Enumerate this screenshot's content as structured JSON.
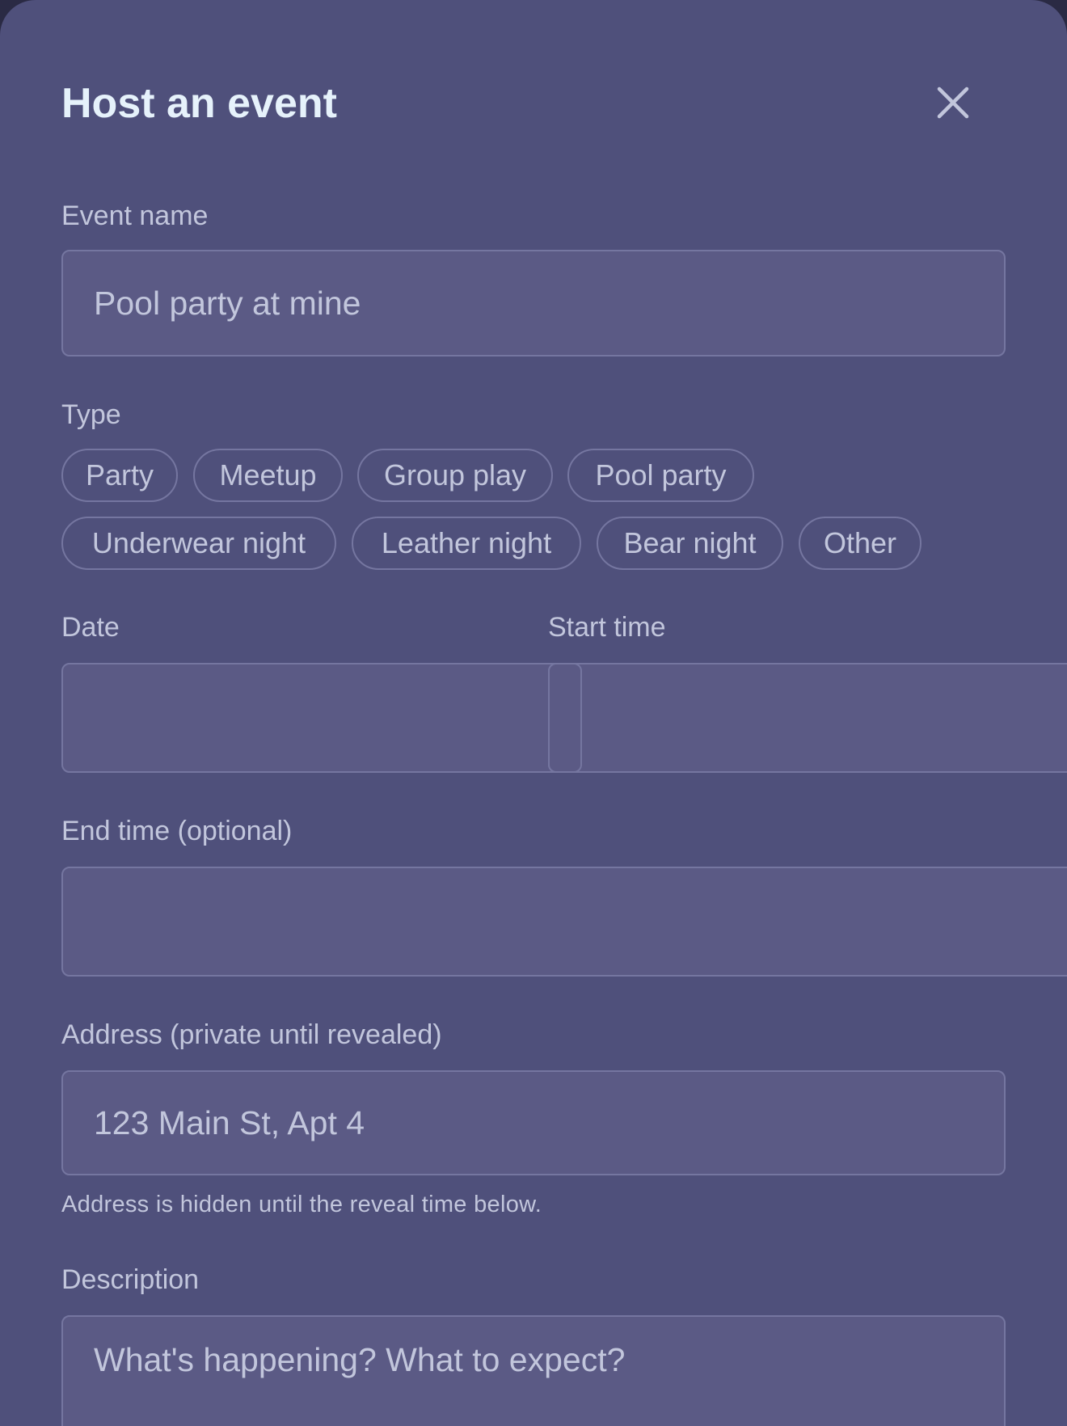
{
  "dialog": {
    "title": "Host an event",
    "close_icon": "close-icon"
  },
  "event_name": {
    "label": "Event name",
    "placeholder": "Pool party at mine"
  },
  "type": {
    "label": "Type",
    "options": [
      "Party",
      "Meetup",
      "Group play",
      "Pool party",
      "Underwear night",
      "Leather night",
      "Bear night",
      "Other"
    ]
  },
  "date": {
    "label": "Date",
    "value": ""
  },
  "start_time": {
    "label": "Start time",
    "value": ""
  },
  "end_time": {
    "label": "End time (optional)",
    "value": ""
  },
  "address": {
    "label": "Address (private until revealed)",
    "placeholder": "123 Main St, Apt 4",
    "hint": "Address is hidden until the reveal time below."
  },
  "description": {
    "label": "Description",
    "placeholder": "What's happening? What to expect?"
  },
  "colors": {
    "background": "#4f507b",
    "field": "#5b5a85",
    "border": "#7576a0",
    "title": "#e6f2fb",
    "text": "#c2c6dc"
  }
}
